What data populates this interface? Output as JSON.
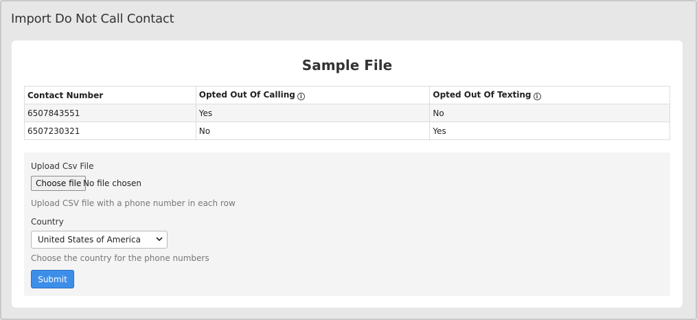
{
  "page": {
    "title": "Import Do Not Call Contact"
  },
  "sample": {
    "heading": "Sample File",
    "columns": [
      "Contact Number",
      "Opted Out Of Calling",
      "Opted Out Of Texting"
    ],
    "rows": [
      [
        "6507843551",
        "Yes",
        "No"
      ],
      [
        "6507230321",
        "No",
        "Yes"
      ]
    ]
  },
  "form": {
    "upload_label": "Upload Csv File",
    "choose_file_label": "Choose file",
    "file_status": "No file chosen",
    "upload_help": "Upload CSV file with a phone number in each row",
    "country_label": "Country",
    "country_selected": "United States of America",
    "country_help": "Choose the country for the phone numbers",
    "submit_label": "Submit"
  },
  "icons": {
    "info": "info-icon",
    "select": "chevron-down-icon"
  },
  "colors": {
    "primary_button": "#3d8ee8",
    "page_background": "#e7e7e7",
    "card_background": "#ffffff",
    "form_background": "#f4f4f4"
  }
}
